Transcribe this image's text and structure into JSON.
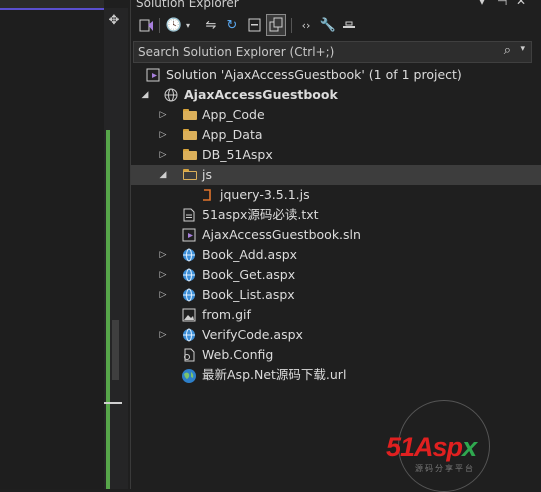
{
  "panel": {
    "title": "Solution Explorer"
  },
  "search": {
    "placeholder": "Search Solution Explorer (Ctrl+;)"
  },
  "tree": {
    "solution": "Solution 'AjaxAccessGuestbook' (1 of 1 project)",
    "project": "AjaxAccessGuestbook",
    "items": [
      {
        "label": "App_Code"
      },
      {
        "label": "App_Data"
      },
      {
        "label": "DB_51Aspx"
      },
      {
        "label": "js"
      },
      {
        "label": "jquery-3.5.1.js"
      },
      {
        "label": "51aspx源码必读.txt"
      },
      {
        "label": "AjaxAccessGuestbook.sln"
      },
      {
        "label": "Book_Add.aspx"
      },
      {
        "label": "Book_Get.aspx"
      },
      {
        "label": "Book_List.aspx"
      },
      {
        "label": "from.gif"
      },
      {
        "label": "VerifyCode.aspx"
      },
      {
        "label": "Web.Config"
      },
      {
        "label": "最新Asp.Net源码下载.url"
      }
    ]
  },
  "watermark": {
    "logo_a": "51",
    "logo_b": "Asp",
    "logo_c": "x",
    "subtitle": "源码分享平台"
  },
  "colors": {
    "accent": "#5a4fcf",
    "folder": "#dcb05a",
    "logo_red": "#e02020",
    "logo_green": "#2fa84f"
  }
}
